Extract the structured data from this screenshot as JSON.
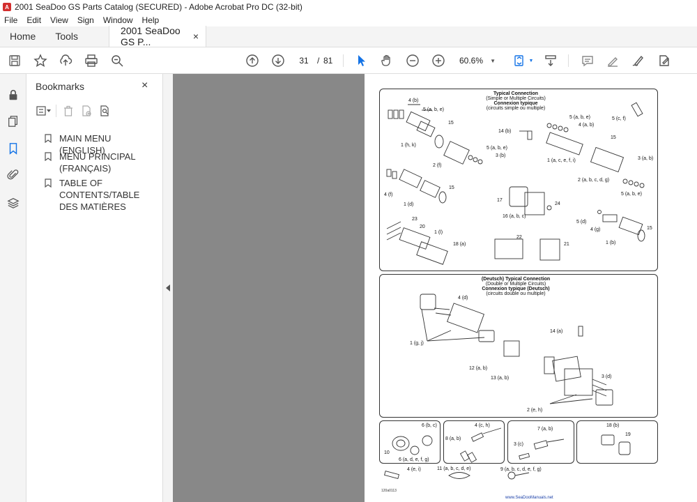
{
  "window": {
    "title": "2001 SeaDoo GS Parts Catalog (SECURED) - Adobe Acrobat Pro DC (32-bit)"
  },
  "menu": [
    "File",
    "Edit",
    "View",
    "Sign",
    "Window",
    "Help"
  ],
  "tabs": {
    "home": "Home",
    "tools": "Tools",
    "document": "2001 SeaDoo GS P...",
    "close": "×"
  },
  "toolbar": {
    "page_current": "31",
    "page_sep": "/",
    "page_total": "81",
    "zoom": "60.6%"
  },
  "bookmarks": {
    "title": "Bookmarks",
    "close": "×",
    "items": [
      {
        "label": "MAIN MENU (ENGLISH)"
      },
      {
        "label": "MENU PRINCIPAL (FRANÇAIS)"
      },
      {
        "label": "TABLE OF CONTENTS/TABLE DES MATIÈRES"
      }
    ]
  },
  "document_page": {
    "panel1": {
      "title_en": "Typical Connection",
      "sub_en": "(Simple or Multiple Circuits)",
      "title_fr": "Connexion typique",
      "sub_fr": "(circuits simple ou multiple)",
      "labels": [
        "4 (b)",
        "5 (a, b, e)",
        "15",
        "1 (h, k)",
        "5 (a, b, e)",
        "3 (b)",
        "2 (f)",
        "15",
        "4 (f)",
        "1 (d)",
        "23",
        "20",
        "1 (l)",
        "18 (a)",
        "22",
        "21",
        "14 (b)",
        "17",
        "16 (a, b, c)",
        "24",
        "5 (a, b, e)",
        "4 (a, b)",
        "5 (c, f)",
        "15",
        "1 (a, c, e, f, i)",
        "3 (a, b)",
        "2 (a, b, c, d, g)",
        "5 (a, b, e)",
        "5 (d)",
        "4 (g)",
        "15",
        "1 (b)"
      ]
    },
    "panel2": {
      "title_en": "(Deutsch) Typical Connection",
      "sub_en": "(Double or Multiple Circuits)",
      "title_fr": "Connexion typique (Deutsch)",
      "sub_fr": "(circuits double ou multiple)",
      "labels": [
        "4 (d)",
        "1 (g, j)",
        "14 (a)",
        "12 (a, b)",
        "13 (a, b)",
        "3 (d)",
        "2 (e, h)"
      ]
    },
    "bottom_labels": [
      "6 (b, c)",
      "10",
      "6 (a, d, e, f, g)",
      "4 (c, h)",
      "8 (a, b)",
      "7 (a, b)",
      "3 (c)",
      "18 (b)",
      "19",
      "4 (e, i)",
      "11 (a, b, c, d, e)",
      "9 (a, b, c, d, e, f, g)"
    ],
    "figure_id": "120a0113",
    "watermark": "www.SeaDooManuals.net"
  }
}
